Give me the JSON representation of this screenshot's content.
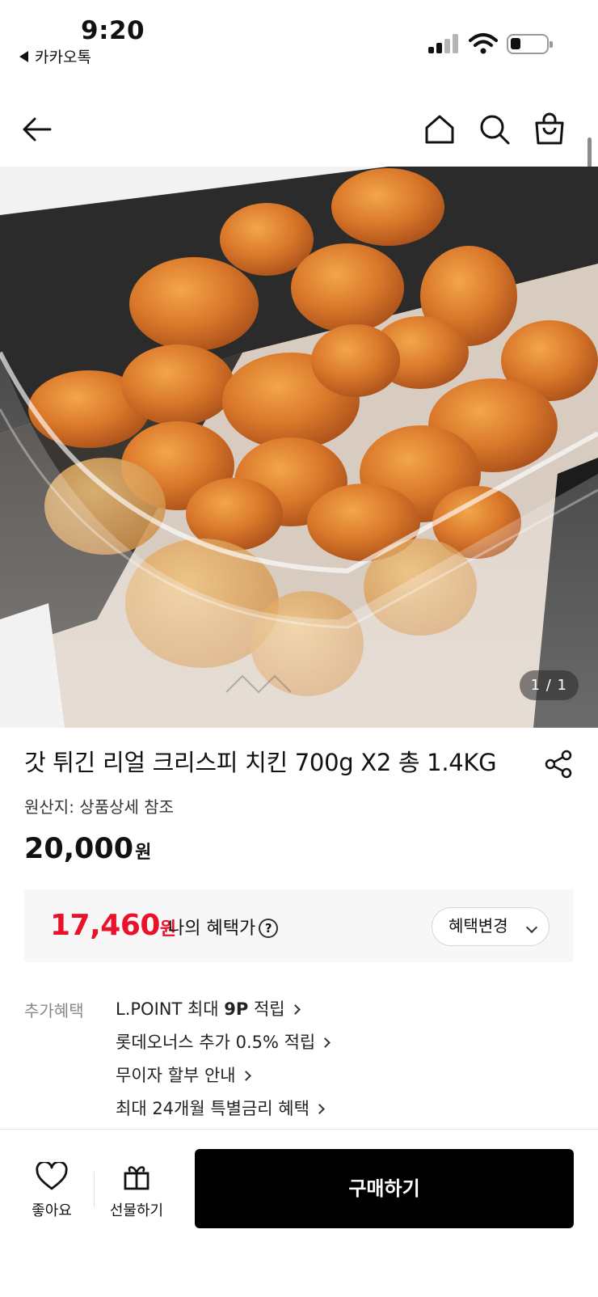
{
  "status_bar": {
    "time": "9:20",
    "back_app": "카카오톡"
  },
  "nav": {
    "icons": [
      "back-arrow-icon",
      "home-icon",
      "search-icon",
      "shopping-bag-icon"
    ]
  },
  "hero": {
    "image_counter": "1 / 1"
  },
  "product": {
    "title": "갓 튀긴 리얼 크리스피 치킨 700g X2 총 1.4KG",
    "origin": "원산지: 상품상세 참조",
    "price": "20,000",
    "price_unit": "원"
  },
  "benefit": {
    "price": "17,460",
    "price_unit": "원",
    "label": "나의 혜택가",
    "help": "?",
    "change_button": "혜택변경"
  },
  "extra_benefits": {
    "label": "추가혜택",
    "items": [
      {
        "prefix": "L.POINT 최대 ",
        "bold": "9P",
        "suffix": " 적립"
      },
      {
        "prefix": "롯데오너스 추가 0.5% 적립",
        "bold": "",
        "suffix": ""
      },
      {
        "prefix": "무이자 할부 안내",
        "bold": "",
        "suffix": ""
      },
      {
        "prefix": "최대 24개월 특별금리 혜택",
        "bold": "",
        "suffix": ""
      }
    ]
  },
  "bottom_bar": {
    "like_label": "좋아요",
    "gift_label": "선물하기",
    "buy_label": "구매하기"
  },
  "colors": {
    "accent_red": "#e8122b",
    "buy_button": "#000000"
  }
}
